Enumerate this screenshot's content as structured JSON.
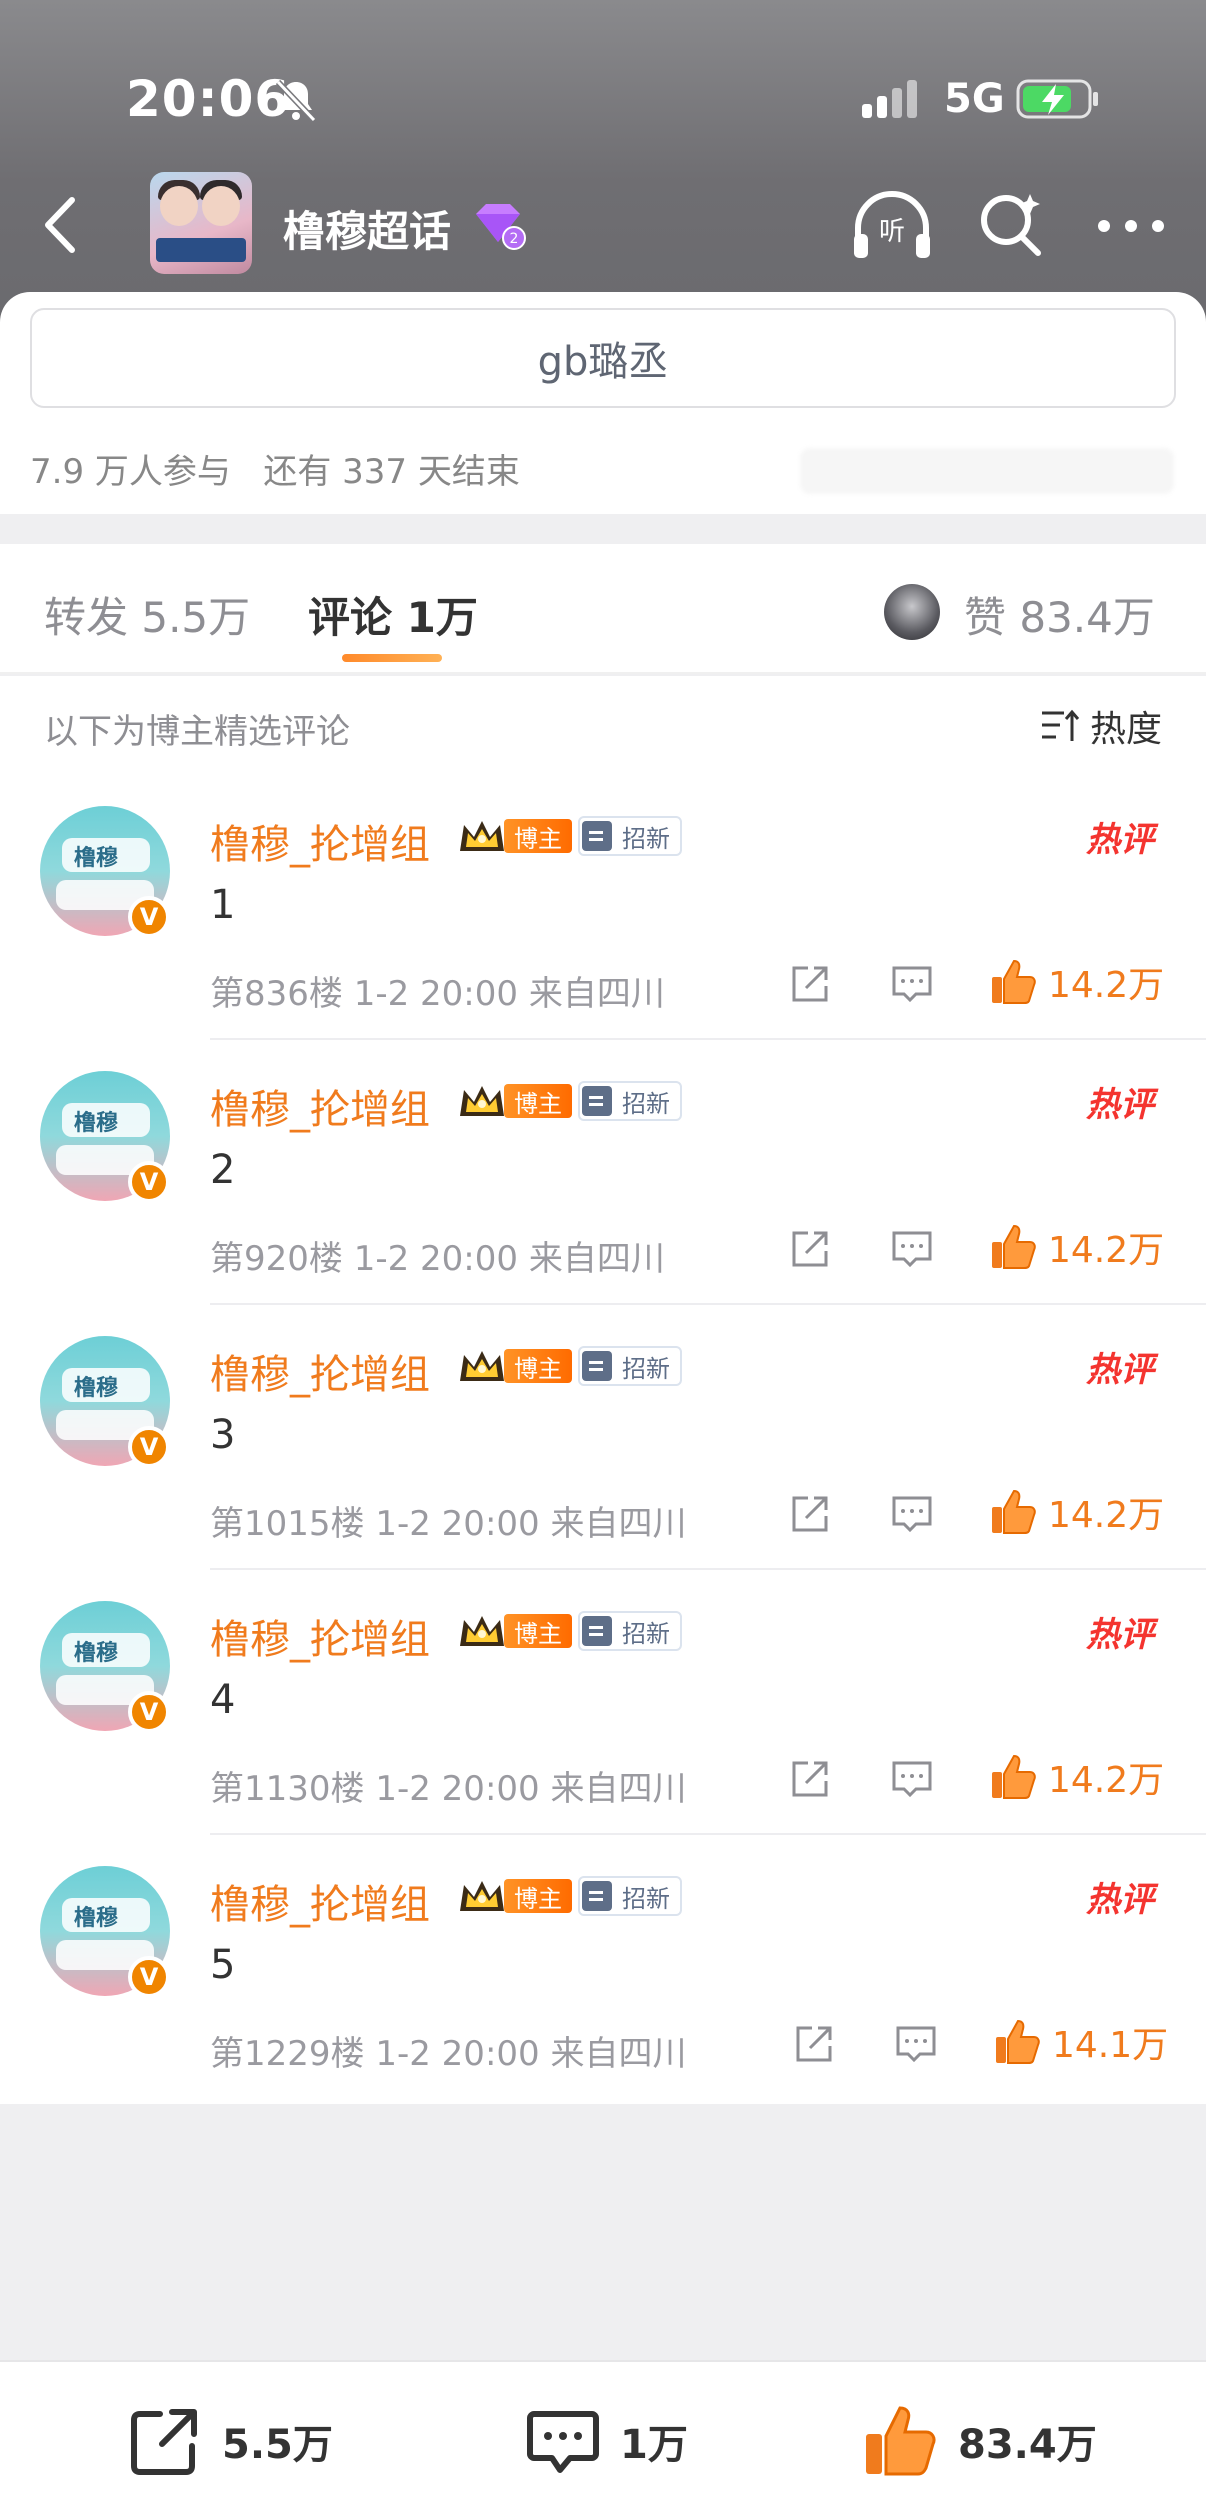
{
  "status_bar": {
    "time": "20:06",
    "network": "5G"
  },
  "nav": {
    "title": "橹穆超话",
    "vip_level": "2"
  },
  "topic": {
    "name": "gb璐丞",
    "participants": "7.9 万人参与",
    "remaining": "还有 337 天结束"
  },
  "tabs": {
    "repost": "转发 5.5万",
    "comment": "评论 1万",
    "likes": "赞 83.4万"
  },
  "comments_section": {
    "note": "以下为博主精选评论",
    "sort_label": "热度"
  },
  "badges": {
    "author": "博主",
    "recruit": "招新",
    "hot": "热评",
    "verified": "V"
  },
  "avatar_text": "橹穆",
  "comments": [
    {
      "name": "橹穆_抡增组",
      "text": "1",
      "meta": "第836楼 1-2 20:00 来自四川",
      "likes": "14.2万"
    },
    {
      "name": "橹穆_抡增组",
      "text": "2",
      "meta": "第920楼 1-2 20:00 来自四川",
      "likes": "14.2万"
    },
    {
      "name": "橹穆_抡增组",
      "text": "3",
      "meta": "第1015楼 1-2 20:00 来自四川",
      "likes": "14.2万"
    },
    {
      "name": "橹穆_抡增组",
      "text": "4",
      "meta": "第1130楼 1-2 20:00 来自四川",
      "likes": "14.2万"
    },
    {
      "name": "橹穆_抡增组",
      "text": "5",
      "meta": "第1229楼 1-2 20:00 来自四川",
      "likes": "14.1万"
    }
  ],
  "bottom_bar": {
    "repost": "5.5万",
    "comment": "1万",
    "like": "83.4万"
  },
  "colors": {
    "accent_orange": "#f07b1d",
    "hot_red": "#f4342f",
    "muted": "#8e8e93"
  }
}
